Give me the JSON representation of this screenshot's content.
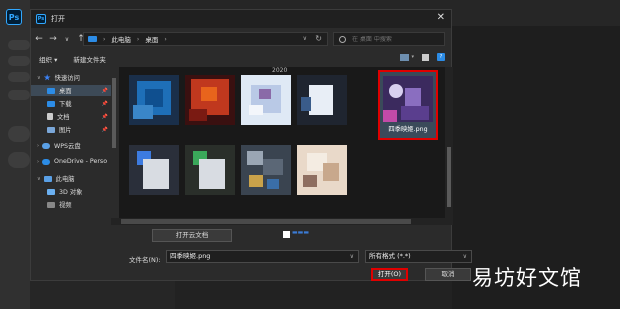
{
  "app": {
    "logo": "Ps"
  },
  "dialog": {
    "title": "打开",
    "close": "✕"
  },
  "address": {
    "segments": [
      "此电脑",
      "桌面"
    ],
    "search_placeholder": "在 桌面 中搜索"
  },
  "toolbar": {
    "organize": "组织 ▾",
    "new_folder": "新建文件夹"
  },
  "sidebar": {
    "items": [
      {
        "label": "快速访问",
        "icon": "star-icon",
        "color": "#3b82f6"
      },
      {
        "label": "桌面",
        "icon": "desktop-icon",
        "color": "#2c8ce6",
        "pinned": true,
        "selected": true
      },
      {
        "label": "下载",
        "icon": "download-icon",
        "color": "#2c8ce6",
        "pinned": true
      },
      {
        "label": "文档",
        "icon": "document-icon",
        "color": "#cccccc",
        "pinned": true
      },
      {
        "label": "图片",
        "icon": "pictures-icon",
        "color": "#7aa7d9",
        "pinned": true
      },
      {
        "label": "WPS云盘",
        "icon": "wps-cloud-icon",
        "color": "#5aa0e6"
      },
      {
        "label": "OneDrive - Perso",
        "icon": "onedrive-icon",
        "color": "#2c8ce6"
      },
      {
        "label": "此电脑",
        "icon": "computer-icon",
        "color": "#5aa0e6"
      },
      {
        "label": "3D 对象",
        "icon": "3d-objects-icon",
        "color": "#6bb0f0"
      },
      {
        "label": "视频",
        "icon": "video-icon",
        "color": "#888888"
      }
    ]
  },
  "grid": {
    "group_label": "2020",
    "selected_file": "四季映姬.png"
  },
  "bottom": {
    "cloud_button": "打开云文档",
    "filename_label": "文件名(N):",
    "filename_value": "四季映姬.png",
    "filetype_value": "所有格式 (*.*)",
    "open_button": "打开(O)",
    "cancel_button": "取消"
  },
  "watermark": "易坊好文馆"
}
